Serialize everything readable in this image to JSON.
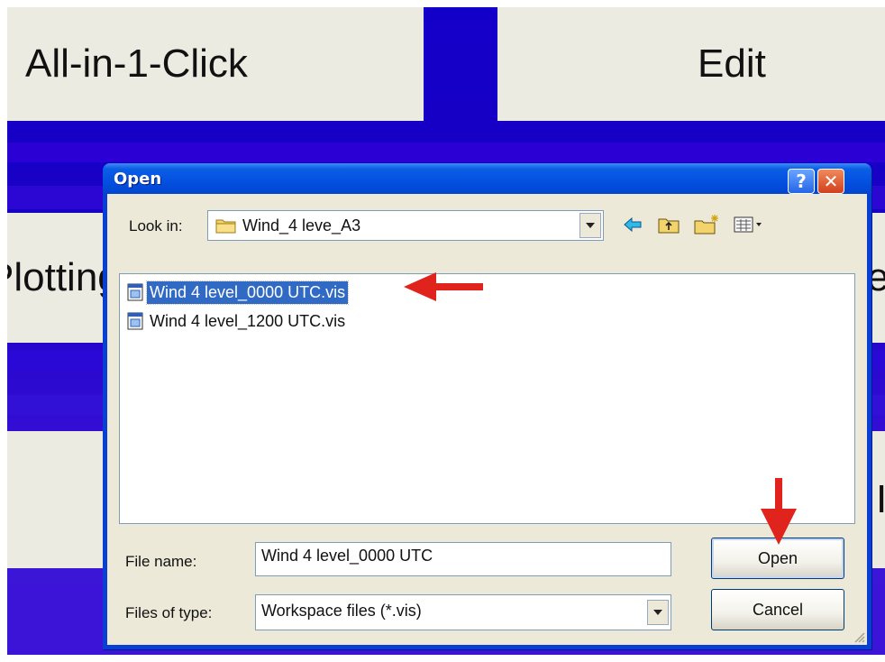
{
  "background": {
    "top_left_button": "All-in-1-Click",
    "top_right_button": "Edit",
    "middle_left_button": "Plotting",
    "middle_right_partial": "e",
    "bottom_right_partial": "I"
  },
  "dialog": {
    "title": "Open",
    "help_label": "?",
    "close_label": "✕",
    "look_in_label": "Look in:",
    "look_in_value": "Wind_4 leve_A3",
    "files": [
      {
        "name": "Wind 4 level_0000 UTC.vis",
        "selected": true
      },
      {
        "name": "Wind 4 level_1200 UTC.vis",
        "selected": false
      }
    ],
    "file_name_label": "File name:",
    "file_name_value": "Wind 4 level_0000 UTC",
    "files_of_type_label": "Files of type:",
    "files_of_type_value": "Workspace files (*.vis)",
    "open_label": "Open",
    "cancel_label": "Cancel"
  },
  "icons": {
    "toolbar": [
      "back-arrow-icon",
      "up-folder-icon",
      "new-folder-icon",
      "view-menu-icon"
    ],
    "annotation": [
      "red-arrow-left-icon",
      "red-arrow-down-icon"
    ]
  },
  "colors": {
    "background_blue": "#1300c8",
    "dialog_title_blue": "#0450e0",
    "selection_blue": "#316ac5",
    "annotation_red": "#e0231c"
  }
}
